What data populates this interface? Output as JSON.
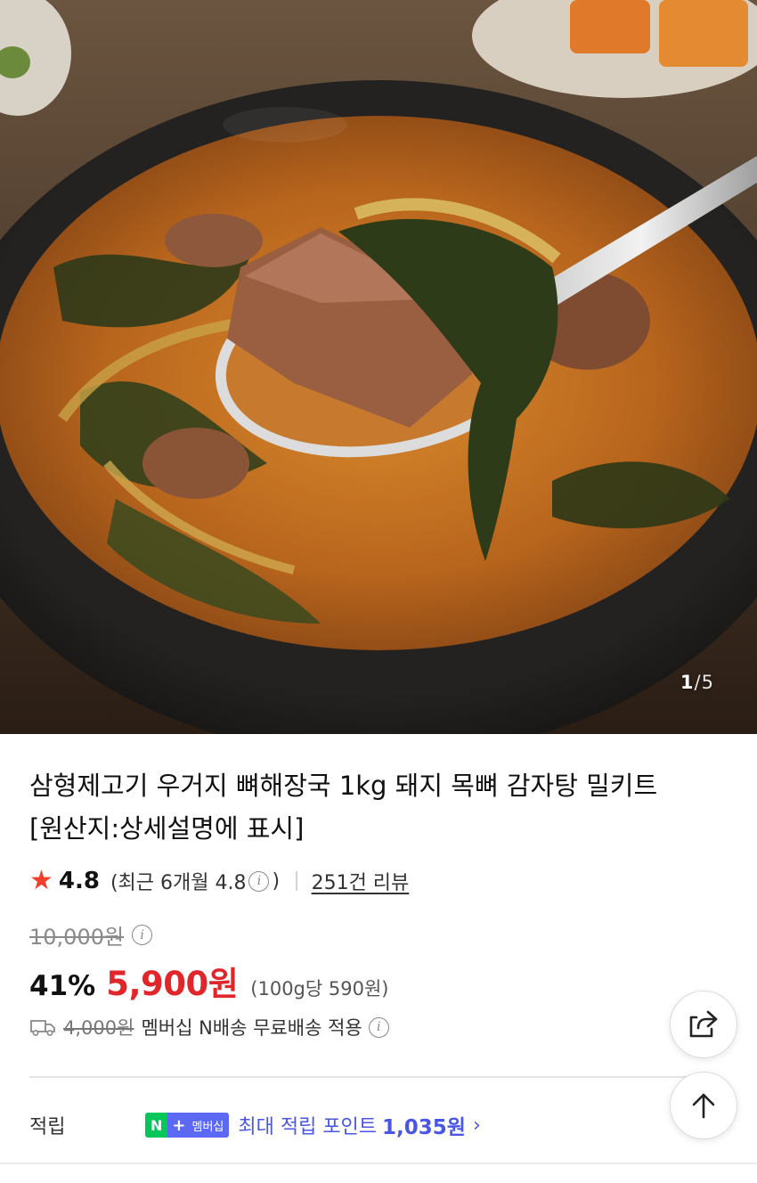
{
  "gallery": {
    "image_alt": "우거지 뼈해장국",
    "current": "1",
    "separator": "/",
    "total": "5"
  },
  "product": {
    "title_line1": "삼형제고기 우거지 뼈해장국 1kg 돼지 목뼈 감자탕 밀키트",
    "title_line2": "[원산지:상세설명에 표시]"
  },
  "rating": {
    "icon": "star-icon",
    "score": "4.8",
    "recent_prefix": "(최근 6개월 4.8",
    "recent_suffix": ")",
    "reviews_link": "251건 리뷰"
  },
  "pricing": {
    "original_price": "10,000원",
    "discount_rate": "41%",
    "sale_price": "5,900원",
    "unit_price": "(100g당 590원)"
  },
  "shipping": {
    "icon": "truck-icon",
    "original_fee": "4,000원",
    "text": "멤버십 N배송 무료배송 적용"
  },
  "points": {
    "label": "적립",
    "badge_n": "N",
    "badge_plus": "+",
    "badge_text": "멤버십",
    "text": "최대 적립 포인트",
    "amount": "1,035원",
    "chevron": "›"
  },
  "colors": {
    "sale_price": "#e0262b",
    "star": "#f2402d",
    "point_accent": "#4a56e6",
    "npay_green": "#04c75a",
    "membership_blue": "#5b69f5"
  },
  "floating_buttons": {
    "share_icon": "share-icon",
    "top_icon": "arrow-up-icon"
  }
}
